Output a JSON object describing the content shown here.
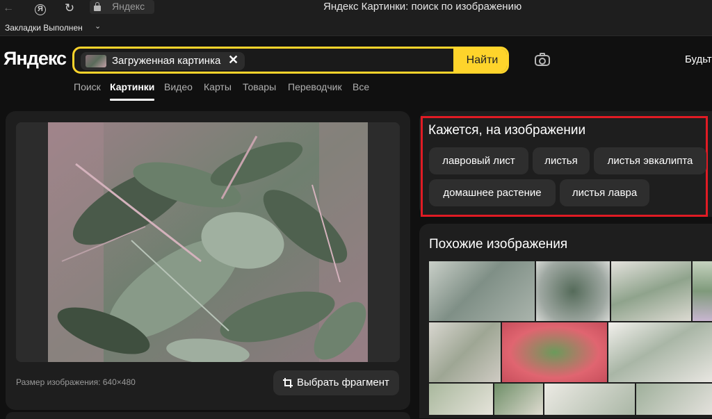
{
  "browser": {
    "url_text": "Яндекс",
    "window_title": "Яндекс Картинки: поиск по изображению",
    "bookmarks_label": "Закладки Выполнен",
    "ya_glyph": "Я"
  },
  "header": {
    "logo": "Яндекс",
    "upload_chip_label": "Загруженная картинка",
    "close_glyph": "✕",
    "find_label": "Найти",
    "right_text": "Будьте"
  },
  "tabs": [
    {
      "label": "Поиск"
    },
    {
      "label": "Картинки",
      "active": true
    },
    {
      "label": "Видео"
    },
    {
      "label": "Карты"
    },
    {
      "label": "Товары"
    },
    {
      "label": "Переводчик"
    },
    {
      "label": "Все"
    }
  ],
  "image_panel": {
    "size_info": "Размер изображения: 640×480",
    "fragment_button": "Выбрать фрагмент"
  },
  "tags": {
    "title": "Кажется, на изображении",
    "items": [
      "лавровый лист",
      "листья",
      "листья эвкалипта",
      "домашнее растение",
      "листья лавра"
    ]
  },
  "similar": {
    "title": "Похожие изображения"
  },
  "colors": {
    "accent_yellow": "#fed42b",
    "highlight_red": "#e01b24",
    "background": "#101010",
    "panel": "#1e1e1e"
  }
}
